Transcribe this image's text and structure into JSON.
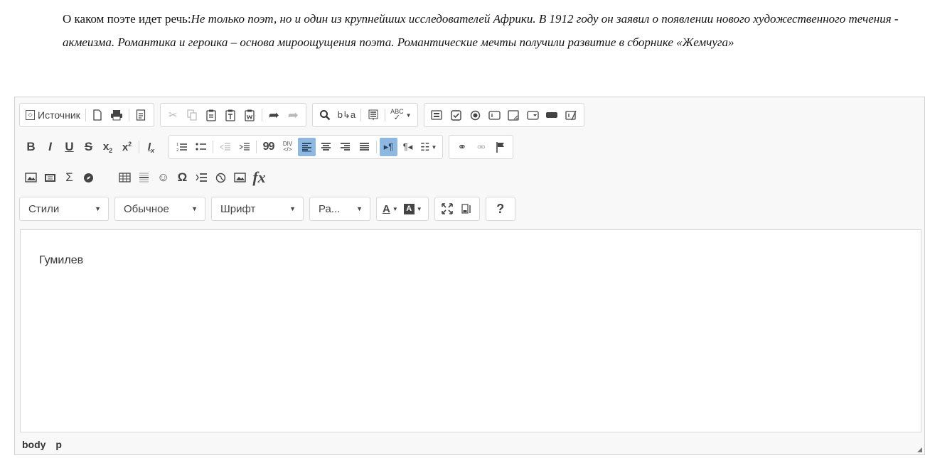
{
  "question": {
    "lead": "О каком поэте идет речь:",
    "body": "Не только поэт, но и один из крупнейших исследователей Африки. В 1912 году он заявил о появлении нового художественного течения - акмеизма. Романтика и героика – основа мироощущения поэта. Романтические мечты получили развитие в сборнике «Жемчуга»"
  },
  "toolbar": {
    "source_label": "Источник",
    "styles_label": "Стили",
    "format_label": "Обычное",
    "font_label": "Шрифт",
    "size_label": "Ра...",
    "spellcheck_label": "ABC",
    "bold_label": "B",
    "italic_label": "I",
    "underline_label": "U",
    "strike_label": "S",
    "quote_label": "99",
    "div_label": "DIV",
    "fx_label": "fx",
    "help_label": "?"
  },
  "editor": {
    "content_text": "Гумилев"
  },
  "statusbar": {
    "path": [
      "body",
      "p"
    ]
  },
  "colors": {
    "active_button": "#8fb8e0",
    "toolbar_bg": "#f8f8f8",
    "border": "#d1d1d1"
  }
}
